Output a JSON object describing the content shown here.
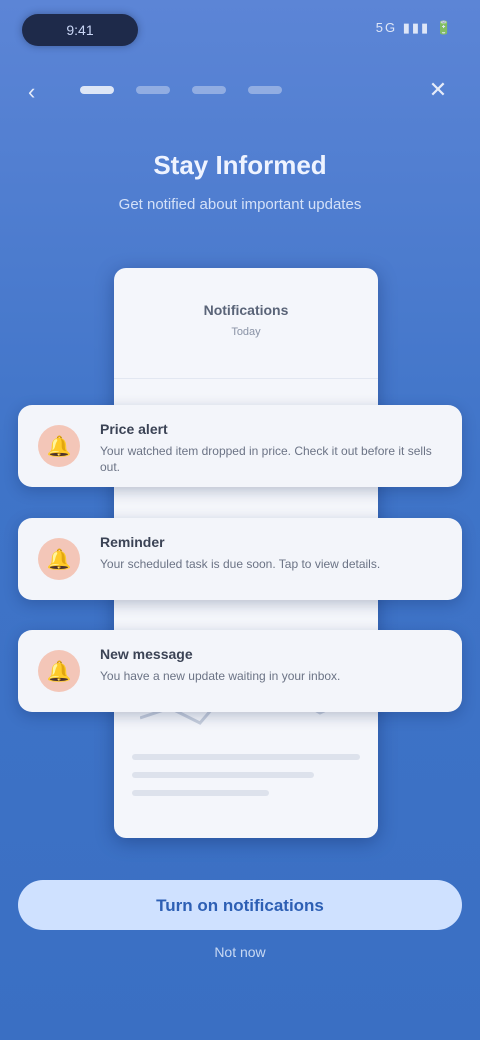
{
  "status": {
    "time": "9:41",
    "indicators": "5G ▮▮▮ 🔋"
  },
  "nav": {
    "back_icon": "chevron-left",
    "close_icon": "close",
    "steps": 4,
    "active_step": 1
  },
  "header": {
    "title": "Stay Informed",
    "subtitle": "Get notified about important updates"
  },
  "phone_preview": {
    "title": "Notifications",
    "subtitle": "Today"
  },
  "notifications": [
    {
      "icon": "bell-icon",
      "title": "Price alert",
      "body": "Your watched item dropped in price. Check it out before it sells out."
    },
    {
      "icon": "bell-icon",
      "title": "Reminder",
      "body": "Your scheduled task is due soon. Tap to view details."
    },
    {
      "icon": "bell-icon",
      "title": "New message",
      "body": "You have a new update waiting in your inbox."
    }
  ],
  "cta": {
    "label": "Turn on notifications"
  },
  "skip": {
    "label": "Not now"
  },
  "colors": {
    "accent": "#3f74c8",
    "cta_bg": "#cfe1ff",
    "avatar_bg": "#f3c6b8"
  }
}
